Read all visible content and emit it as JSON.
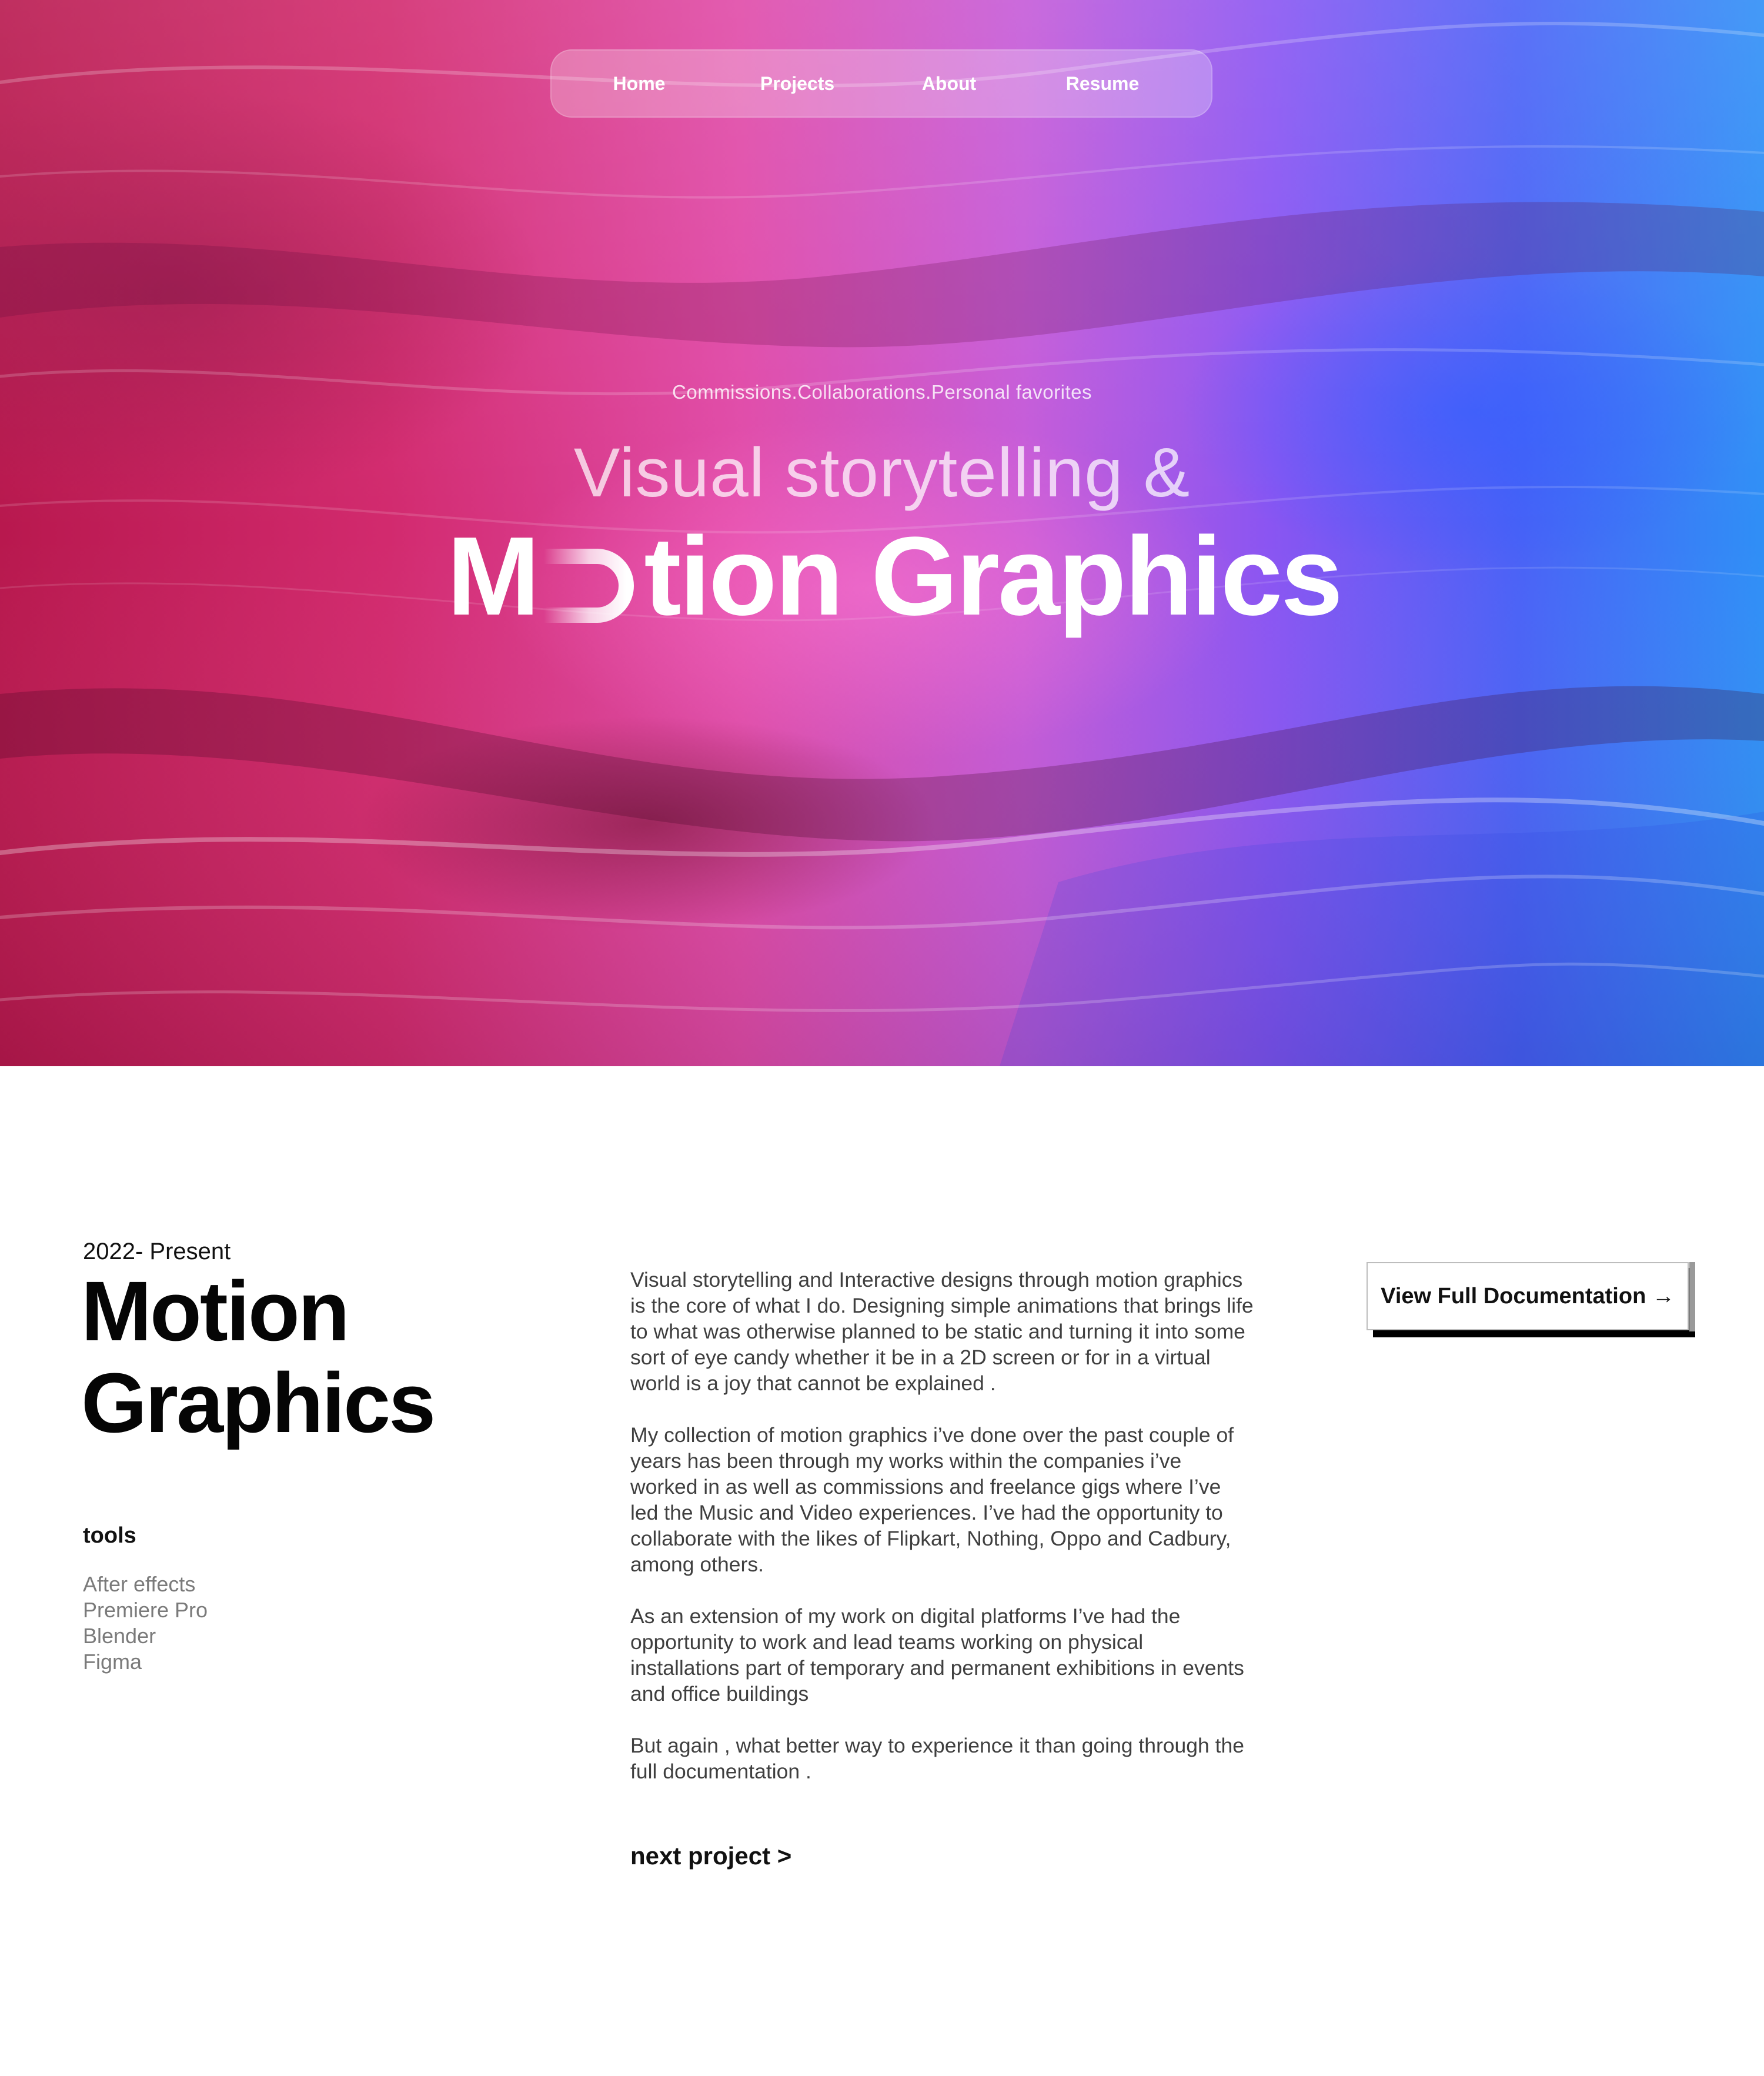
{
  "nav": {
    "items": [
      {
        "label": "Home"
      },
      {
        "label": "Projects"
      },
      {
        "label": "About"
      },
      {
        "label": "Resume"
      }
    ]
  },
  "hero": {
    "kicker": "Commissions.Collaborations.Personal favorites",
    "line1": "Visual storytelling &",
    "line2_first_letter": "M",
    "line2_rest": "tion Graphics"
  },
  "project": {
    "period": "2022- Present",
    "title_line1": "Motion",
    "title_line2": "Graphics",
    "tools_heading": "tools",
    "tools": [
      "After effects",
      "Premiere Pro",
      "Blender",
      "Figma"
    ],
    "paragraphs": [
      "Visual storytelling and Interactive designs through motion graphics is the core of what I do. Designing simple animations that brings life to what was otherwise planned to be static and turning it into some sort of eye candy whether it be in a 2D screen or for in a virtual world is a joy that cannot be explained .",
      "My collection of motion graphics i’ve done over the past couple of years has been through my works within the companies i’ve worked in as well as commissions and freelance gigs where I’ve led the Music and Video experiences. I’ve had the opportunity to collaborate with the likes of Flipkart, Nothing, Oppo and Cadbury, among others.",
      "As an extension of my work on digital platforms I’ve had the opportunity to work and lead teams working on physical installations part of temporary and permanent exhibitions in events and office buildings",
      "But again , what better way to experience it than going through the full documentation ."
    ],
    "next_link": "next project >",
    "doc_button": "View Full Documentation →"
  }
}
